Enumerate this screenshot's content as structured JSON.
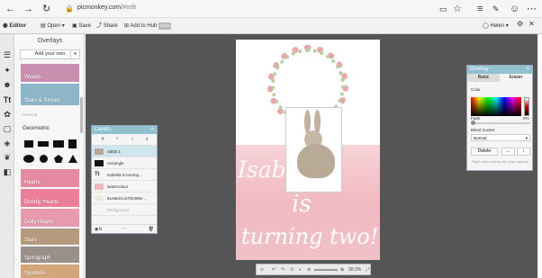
{
  "browser": {
    "url_host": "picmonkey.com",
    "url_path": "/#edit",
    "icons": [
      "back-icon",
      "forward-icon",
      "refresh-icon",
      "lock-icon",
      "reader-icon",
      "star-icon",
      "menu-icon",
      "pen-icon",
      "profile-icon",
      "more-icon"
    ]
  },
  "appbar": {
    "editor": "Editor",
    "open": "Open",
    "save": "Save",
    "share": "Share",
    "add_to_hub": "Add to Hub",
    "badge": "BETA",
    "user": "Helen"
  },
  "overlays_panel": {
    "title": "Overlays",
    "your_own": "Add your own",
    "categories_top": [
      {
        "label": "Weeds",
        "color": "#c98fb0"
      },
      {
        "label": "Stars & Stripes",
        "color": "#8db7c9"
      }
    ],
    "sub_label": "General",
    "geometric_title": "Geometric",
    "categories_bottom": [
      {
        "label": "Hearts",
        "color": "#e58aa2"
      },
      {
        "label": "Doodly Hearts",
        "color": "#eb7f9a"
      },
      {
        "label": "Doily Hearts",
        "color": "#e79aae"
      },
      {
        "label": "Stars",
        "color": "#b59a7e"
      },
      {
        "label": "Spirograph",
        "color": "#9b8f89"
      },
      {
        "label": "Symbols",
        "color": "#d3a67a"
      }
    ]
  },
  "layers_panel": {
    "title": "Layers",
    "close": "×",
    "rows": [
      {
        "label": "rabbit 1",
        "thumb": "#b7a899",
        "selected": true
      },
      {
        "label": "rectangle",
        "thumb": "#111111",
        "selected": false
      },
      {
        "label": "Isabella is turning...",
        "thumb": "#ffffff",
        "selected": false
      },
      {
        "label": "watercolour",
        "thumb": "#f0b6c0",
        "selected": false
      },
      {
        "label": "61e8e2cca7b0469e...",
        "thumb": "#e9eadf",
        "selected": false
      }
    ],
    "background": "Background"
  },
  "overlay_panel": {
    "title": "Overlay",
    "close": "×",
    "tab_basic": "Basic",
    "tab_eraser": "Eraser",
    "color_label": "Color",
    "fade_label": "Fade",
    "fade_value": "0%",
    "blend_label": "Blend modes:",
    "blend_value": "Normal",
    "delete_label": "Delete",
    "tip": "Right-click overlay for more options."
  },
  "canvas": {
    "text_line1": "Isabella",
    "text_line2": "is",
    "text_line3": "turning two!"
  },
  "bottombar": {
    "zoom": "30.3%"
  }
}
